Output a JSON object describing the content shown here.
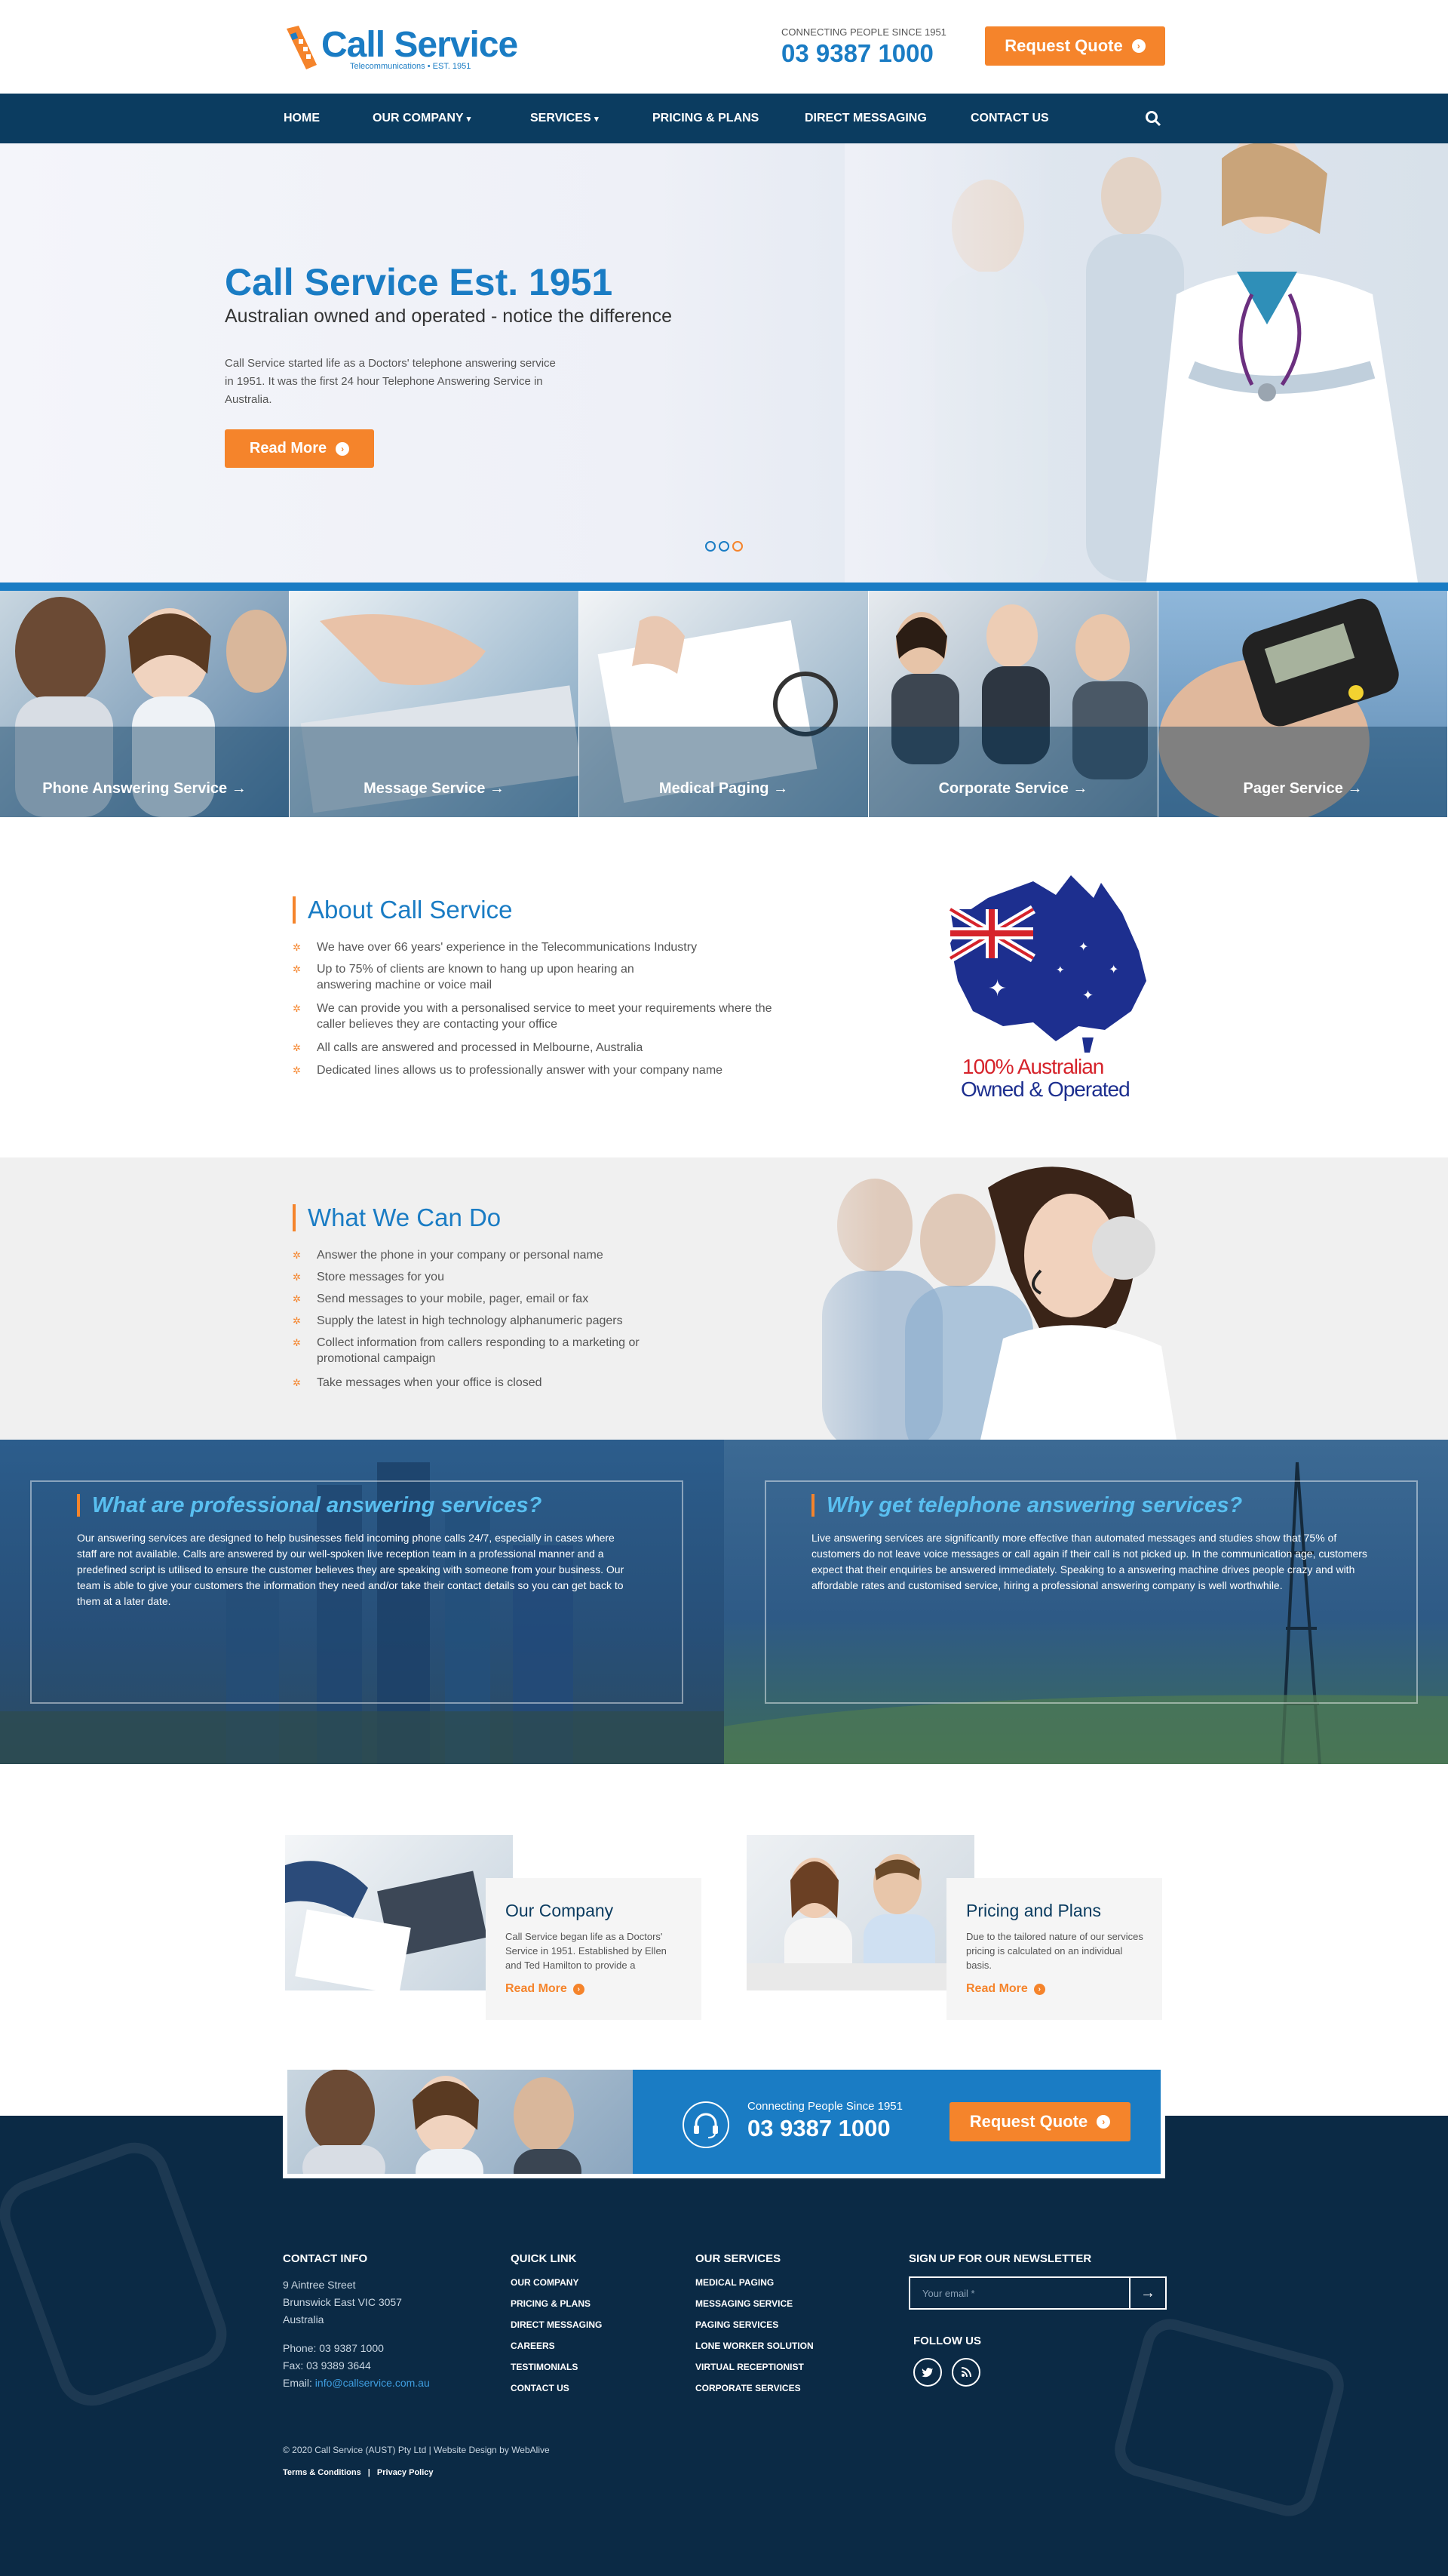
{
  "header": {
    "logo_name": "Call Service",
    "logo_tagline": "Telecommunications • EST. 1951",
    "since": "CONNECTING PEOPLE SINCE 1951",
    "phone": "03 9387 1000",
    "quote_label": "Request Quote"
  },
  "nav": {
    "items": [
      {
        "label": "HOME"
      },
      {
        "label": "OUR COMPANY"
      },
      {
        "label": "SERVICES"
      },
      {
        "label": "PRICING & PLANS"
      },
      {
        "label": "DIRECT MESSAGING"
      },
      {
        "label": "CONTACT US"
      }
    ],
    "search_icon": "search-icon"
  },
  "hero": {
    "title": "Call Service Est. 1951",
    "subtitle": "Australian owned and operated - notice the difference",
    "body": "Call Service started life as a Doctors' telephone answering service in 1951. It was the first 24 hour Telephone Answering Service in Australia.",
    "button": "Read More"
  },
  "services": [
    {
      "label": "Phone Answering Service"
    },
    {
      "label": "Message Service"
    },
    {
      "label": "Medical Paging"
    },
    {
      "label": "Corporate Service"
    },
    {
      "label": "Pager Service"
    }
  ],
  "about": {
    "title": "About Call Service",
    "items": [
      "We have over 66 years' experience in the Telecommunications Industry",
      "Up to 75% of clients are known to hang up upon hearing an answering machine or voice mail",
      "We can provide you with a personalised service to meet your requirements where the caller believes they are contacting your office",
      "All calls are answered and processed in Melbourne, Australia",
      "Dedicated lines allows us to professionally answer with your company name"
    ],
    "badge_line1": "100% Australian",
    "badge_line2": "Owned & Operated"
  },
  "whatwecan": {
    "title": "What We Can Do",
    "items": [
      "Answer the phone in your company or personal name",
      "Store messages for you",
      "Send messages to your mobile, pager, email or fax",
      "Supply the latest in high technology alphanumeric pagers",
      "Collect information from callers responding to a marketing or promotional campaign",
      "Take messages when your office is closed"
    ]
  },
  "info": [
    {
      "title": "What are professional answering services?",
      "body": "Our answering services are designed to help businesses field incoming phone calls 24/7, especially in cases where staff are not available. Calls are answered by our well-spoken live reception team in a professional manner and a predefined script is utilised to ensure the customer believes they are speaking with someone from your business. Our team is able to give your customers the information they need and/or take their contact details so you can get back to them at a later date."
    },
    {
      "title": "Why get telephone answering services?",
      "body": "Live answering services are significantly more effective than automated messages and studies show that 75% of customers do not leave voice messages or call again if their call is not picked up. In the communication age, customers expect that their enquiries be answered immediately. Speaking to a answering machine drives people crazy and with affordable rates and customised service, hiring a professional answering company is well worthwhile."
    }
  ],
  "cards": [
    {
      "title": "Our Company",
      "body": "Call Service began life as a Doctors' Service in 1951. Established by Ellen and Ted Hamilton to provide a",
      "more": "Read More"
    },
    {
      "title": "Pricing and Plans",
      "body": "Due to the tailored nature of our services pricing is calculated on an individual basis.",
      "more": "Read More"
    }
  ],
  "cta": {
    "since": "Connecting People Since 1951",
    "phone": "03 9387 1000",
    "button": "Request Quote"
  },
  "footer": {
    "contact_title": "CONTACT INFO",
    "address1": "9 Aintree Street",
    "address2": "Brunswick East VIC 3057",
    "address3": "Australia",
    "phone": "Phone: 03 9387 1000",
    "fax": "Fax: 03 9389 3644",
    "email_label": "Email: ",
    "email": "info@callservice.com.au",
    "quick_title": "QUICK LINK",
    "quick_links": [
      "OUR COMPANY",
      "PRICING & PLANS",
      "DIRECT MESSAGING",
      "CAREERS",
      "TESTIMONIALS",
      "CONTACT US"
    ],
    "services_title": "OUR SERVICES",
    "service_links": [
      "MEDICAL PAGING",
      "MESSAGING SERVICE",
      "PAGING SERVICES",
      "LONE WORKER SOLUTION",
      "VIRTUAL RECEPTIONIST",
      "CORPORATE SERVICES"
    ],
    "newsletter_title": "SIGN UP FOR OUR NEWSLETTER",
    "newsletter_placeholder": "Your email *",
    "follow_title": "FOLLOW US",
    "copyright": "© 2020 Call Service (AUST) Pty Ltd |  Website Design by WebAlive",
    "terms": "Terms & Conditions",
    "privacy": "Privacy Policy"
  },
  "colors": {
    "brand_blue": "#1a7cc4",
    "navy": "#0b3c60",
    "orange": "#f5842b",
    "footer": "#0b2a45"
  }
}
